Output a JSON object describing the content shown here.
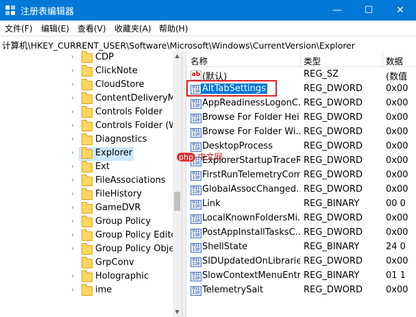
{
  "window": {
    "title": "注册表编辑器",
    "minimize": "—",
    "maximize": "☐",
    "close": "✕"
  },
  "menu": [
    "文件(F)",
    "编辑(E)",
    "查看(V)",
    "收藏夹(A)",
    "帮助(H)"
  ],
  "address": "计算机\\HKEY_CURRENT_USER\\Software\\Microsoft\\Windows\\CurrentVersion\\Explorer",
  "tree": {
    "items": [
      "CDP",
      "ClickNote",
      "CloudStore",
      "ContentDeliveryMa",
      "Controls Folder",
      "Controls Folder (W",
      "Diagnostics",
      "Explorer",
      "Ext",
      "FileAssociations",
      "FileHistory",
      "GameDVR",
      "Group Policy",
      "Group Policy Edito",
      "Group Policy Objec",
      "GrpConv",
      "Holographic",
      "ime"
    ],
    "selected": "Explorer"
  },
  "columns": {
    "name": "名称",
    "type": "类型",
    "data": "数据"
  },
  "rows": [
    {
      "icon": "ab",
      "name": "(默认)",
      "type": "REG_SZ",
      "data": "(数值"
    },
    {
      "icon": "bin",
      "name": "AltTabSettings",
      "type": "REG_DWORD",
      "data": "0x00"
    },
    {
      "icon": "bin",
      "name": "AppReadinessLogonC...",
      "type": "REG_DWORD",
      "data": "0x00"
    },
    {
      "icon": "bin",
      "name": "Browse For Folder Hei...",
      "type": "REG_DWORD",
      "data": "0x00"
    },
    {
      "icon": "bin",
      "name": "Browse For Folder Wi...",
      "type": "REG_DWORD",
      "data": "0x00"
    },
    {
      "icon": "bin",
      "name": "DesktopProcess",
      "type": "REG_DWORD",
      "data": "0x00"
    },
    {
      "icon": "bin",
      "name": "ExplorerStartupTraceR...",
      "type": "REG_DWORD",
      "data": "0x00"
    },
    {
      "icon": "bin",
      "name": "FirstRunTelemetryCom...",
      "type": "REG_DWORD",
      "data": "0x00"
    },
    {
      "icon": "bin",
      "name": "GlobalAssocChanged...",
      "type": "REG_DWORD",
      "data": "0x00"
    },
    {
      "icon": "bin",
      "name": "Link",
      "type": "REG_BINARY",
      "data": "00 0"
    },
    {
      "icon": "bin",
      "name": "LocalKnownFoldersMi...",
      "type": "REG_DWORD",
      "data": "0x00"
    },
    {
      "icon": "bin",
      "name": "PostAppInstallTasksC...",
      "type": "REG_DWORD",
      "data": "0x00"
    },
    {
      "icon": "bin",
      "name": "ShellState",
      "type": "REG_BINARY",
      "data": "24 0"
    },
    {
      "icon": "bin",
      "name": "SIDUpdatedOnLibraries",
      "type": "REG_DWORD",
      "data": "0x00"
    },
    {
      "icon": "bin",
      "name": "SlowContextMenuEntri...",
      "type": "REG_BINARY",
      "data": "01 1"
    },
    {
      "icon": "bin",
      "name": "TelemetrySalt",
      "type": "REG_DWORD",
      "data": "0x00"
    }
  ],
  "selected_value": "AltTabSettings",
  "watermark": {
    "badge": "php",
    "text": "中文网"
  }
}
